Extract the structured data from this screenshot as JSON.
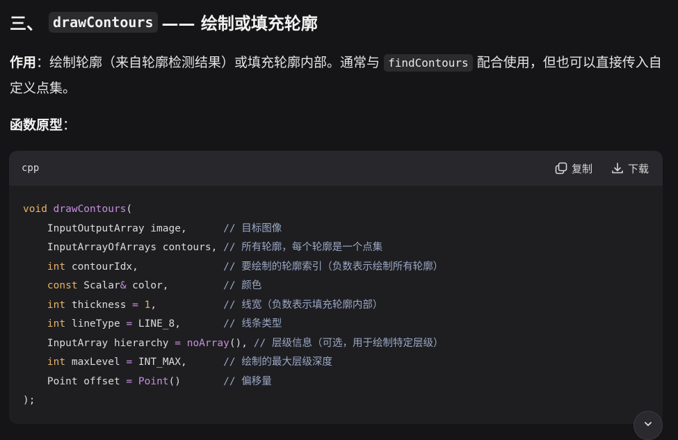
{
  "heading": {
    "prefix": "三、",
    "code": "drawContours",
    "suffix": "—— 绘制或填充轮廓"
  },
  "description": {
    "label": "作用",
    "text_before": "：绘制轮廓（来自轮廓检测结果）或填充轮廓内部。通常与 ",
    "code": "findContours",
    "text_after": " 配合使用，但也可以直接传入自定义点集。"
  },
  "prototype": {
    "label": "函数原型",
    "colon": "："
  },
  "code_block": {
    "language": "cpp",
    "copy_label": "复制",
    "download_label": "下载",
    "lines": [
      [
        {
          "t": "void",
          "c": "kw"
        },
        {
          "t": " "
        },
        {
          "t": "drawContours",
          "c": "fn"
        },
        {
          "t": "("
        }
      ],
      [
        {
          "t": "    InputOutputArray image,      "
        },
        {
          "t": "// 目标图像",
          "c": "cm"
        }
      ],
      [
        {
          "t": "    InputArrayOfArrays contours, "
        },
        {
          "t": "// 所有轮廓，每个轮廓是一个点集",
          "c": "cm"
        }
      ],
      [
        {
          "t": "    "
        },
        {
          "t": "int",
          "c": "kw"
        },
        {
          "t": " contourIdx,              "
        },
        {
          "t": "// 要绘制的轮廓索引（负数表示绘制所有轮廓）",
          "c": "cm"
        }
      ],
      [
        {
          "t": "    "
        },
        {
          "t": "const",
          "c": "kw"
        },
        {
          "t": " Scalar"
        },
        {
          "t": "&",
          "c": "op"
        },
        {
          "t": " color,         "
        },
        {
          "t": "// 颜色",
          "c": "cm"
        }
      ],
      [
        {
          "t": "    "
        },
        {
          "t": "int",
          "c": "kw"
        },
        {
          "t": " thickness "
        },
        {
          "t": "=",
          "c": "op"
        },
        {
          "t": " "
        },
        {
          "t": "1",
          "c": "num"
        },
        {
          "t": ",           "
        },
        {
          "t": "// 线宽（负数表示填充轮廓内部）",
          "c": "cm"
        }
      ],
      [
        {
          "t": "    "
        },
        {
          "t": "int",
          "c": "kw"
        },
        {
          "t": " lineType "
        },
        {
          "t": "=",
          "c": "op"
        },
        {
          "t": " LINE_8,       "
        },
        {
          "t": "// 线条类型",
          "c": "cm"
        }
      ],
      [
        {
          "t": "    InputArray hierarchy "
        },
        {
          "t": "=",
          "c": "op"
        },
        {
          "t": " "
        },
        {
          "t": "noArray",
          "c": "fn"
        },
        {
          "t": "(), "
        },
        {
          "t": "// 层级信息（可选，用于绘制特定层级）",
          "c": "cm"
        }
      ],
      [
        {
          "t": "    "
        },
        {
          "t": "int",
          "c": "kw"
        },
        {
          "t": " maxLevel "
        },
        {
          "t": "=",
          "c": "op"
        },
        {
          "t": " INT_MAX,      "
        },
        {
          "t": "// 绘制的最大层级深度",
          "c": "cm"
        }
      ],
      [
        {
          "t": "    Point offset "
        },
        {
          "t": "=",
          "c": "op"
        },
        {
          "t": " "
        },
        {
          "t": "Point",
          "c": "fn"
        },
        {
          "t": "()       "
        },
        {
          "t": "// 偏移量",
          "c": "cm"
        }
      ],
      [
        {
          "t": ");"
        }
      ]
    ]
  },
  "icons": {
    "copy": "copy-icon",
    "download": "download-icon",
    "scroll": "chevron-down-icon"
  }
}
